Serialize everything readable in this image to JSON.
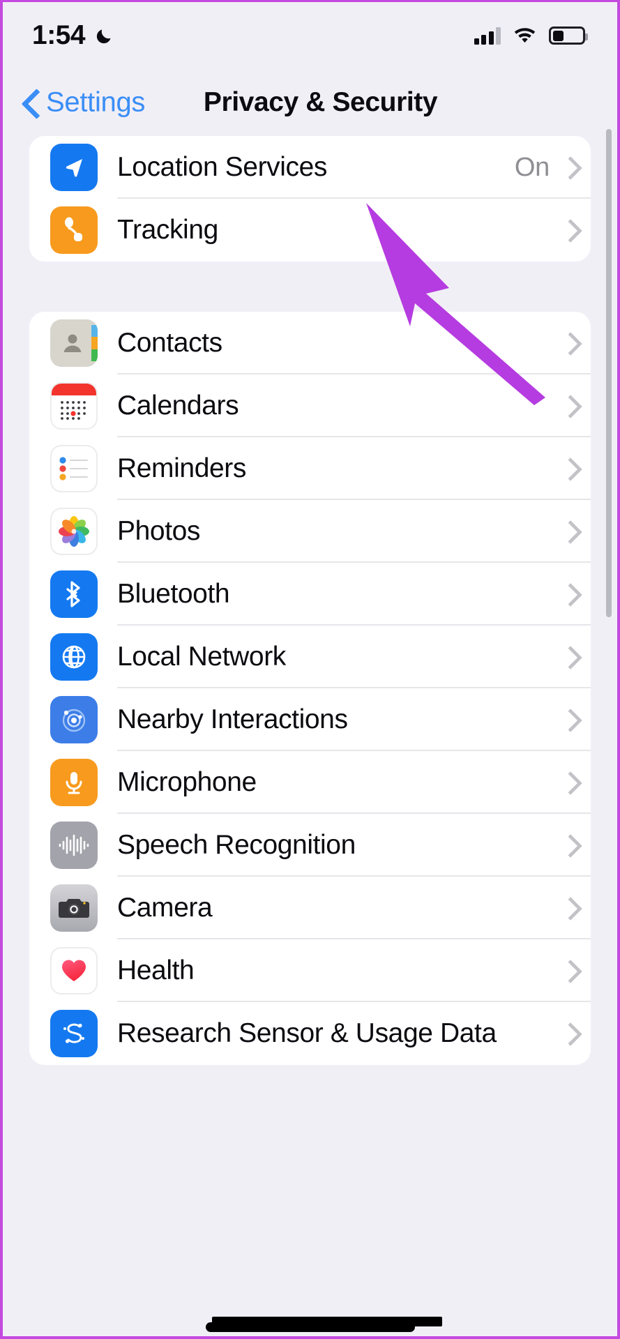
{
  "status_bar": {
    "time": "1:54",
    "dnd_icon": "crescent-moon-icon",
    "cellular_icon": "signal-bars-icon",
    "wifi_icon": "wifi-icon",
    "battery_icon": "battery-icon",
    "battery_level_pct": 38
  },
  "nav": {
    "back_label": "Settings",
    "back_icon": "chevron-left-icon",
    "title": "Privacy & Security"
  },
  "colors": {
    "accent_blue": "#3a8ef6",
    "page_background": "#f1eff6",
    "card_background": "#ffffff",
    "separator": "#e6e6ea",
    "secondary_text": "#8e8e93",
    "annotation_purple": "#b53ce0",
    "frame_purple": "#c44ae0"
  },
  "annotation": {
    "type": "arrow",
    "points_to": "Location Services",
    "color": "#b53ce0"
  },
  "sections": [
    {
      "name": "privacy-top",
      "rows": [
        {
          "label": "Location Services",
          "value": "On",
          "icon": "location-arrow-icon",
          "icon_style": "ic-location",
          "chevron": true
        },
        {
          "label": "Tracking",
          "value": "",
          "icon": "tracking-icon",
          "icon_style": "ic-tracking",
          "chevron": true
        }
      ]
    },
    {
      "name": "app-permissions",
      "rows": [
        {
          "label": "Contacts",
          "value": "",
          "icon": "contacts-icon",
          "icon_style": "ic-contacts",
          "chevron": true
        },
        {
          "label": "Calendars",
          "value": "",
          "icon": "calendar-icon",
          "icon_style": "ic-calendars",
          "chevron": true
        },
        {
          "label": "Reminders",
          "value": "",
          "icon": "reminders-icon",
          "icon_style": "ic-reminders",
          "chevron": true
        },
        {
          "label": "Photos",
          "value": "",
          "icon": "photos-icon",
          "icon_style": "ic-photos",
          "chevron": true
        },
        {
          "label": "Bluetooth",
          "value": "",
          "icon": "bluetooth-icon",
          "icon_style": "ic-bluetooth",
          "chevron": true
        },
        {
          "label": "Local Network",
          "value": "",
          "icon": "globe-network-icon",
          "icon_style": "ic-localnet",
          "chevron": true
        },
        {
          "label": "Nearby Interactions",
          "value": "",
          "icon": "nearby-radar-icon",
          "icon_style": "ic-nearby",
          "chevron": true
        },
        {
          "label": "Microphone",
          "value": "",
          "icon": "microphone-icon",
          "icon_style": "ic-microphone",
          "chevron": true
        },
        {
          "label": "Speech Recognition",
          "value": "",
          "icon": "waveform-icon",
          "icon_style": "ic-speech",
          "chevron": true
        },
        {
          "label": "Camera",
          "value": "",
          "icon": "camera-icon",
          "icon_style": "ic-camera",
          "chevron": true
        },
        {
          "label": "Health",
          "value": "",
          "icon": "heart-icon",
          "icon_style": "ic-health",
          "chevron": true
        },
        {
          "label": "Research Sensor & Usage Data",
          "value": "",
          "icon": "research-sensor-icon",
          "icon_style": "ic-research",
          "chevron": true
        }
      ]
    }
  ]
}
